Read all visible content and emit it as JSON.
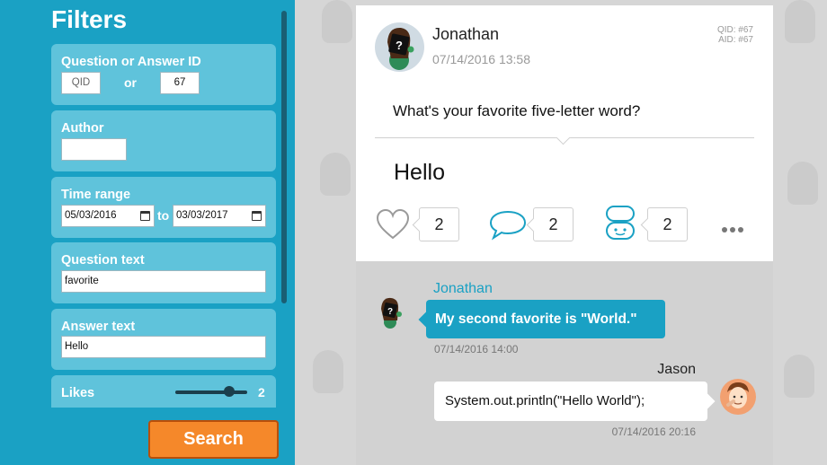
{
  "sidebar": {
    "title": "Filters",
    "id_filter": {
      "label": "Question or Answer ID",
      "qid_placeholder": "QID",
      "or_text": "or",
      "aid_value": "67"
    },
    "author": {
      "label": "Author",
      "value": ""
    },
    "time_range": {
      "label": "Time range",
      "from": "05/03/2016",
      "to_text": "to",
      "to": "03/03/2017"
    },
    "question_text": {
      "label": "Question text",
      "value": "favorite"
    },
    "answer_text": {
      "label": "Answer text",
      "value": "Hello"
    },
    "likes": {
      "label": "Likes",
      "value": "2",
      "slider_fraction": 0.75
    },
    "search_label": "Search"
  },
  "post": {
    "author": "Jonathan",
    "timestamp": "07/14/2016 13:58",
    "qid_label": "QID: #67",
    "aid_label": "AID: #67",
    "question": "What's your favorite five-letter word?",
    "answer": "Hello",
    "likes_count": "2",
    "comments_count": "2",
    "friends_count": "2"
  },
  "comments": [
    {
      "author": "Jonathan",
      "text": "My second favorite is \"World.\"",
      "time": "07/14/2016 14:00"
    },
    {
      "author": "Jason",
      "text": "System.out.println(\"Hello World\");",
      "time": "07/14/2016 20:16"
    }
  ],
  "colors": {
    "accent": "#1aa1c4",
    "card": "#5fc3db",
    "search_button": "#f5882a"
  }
}
